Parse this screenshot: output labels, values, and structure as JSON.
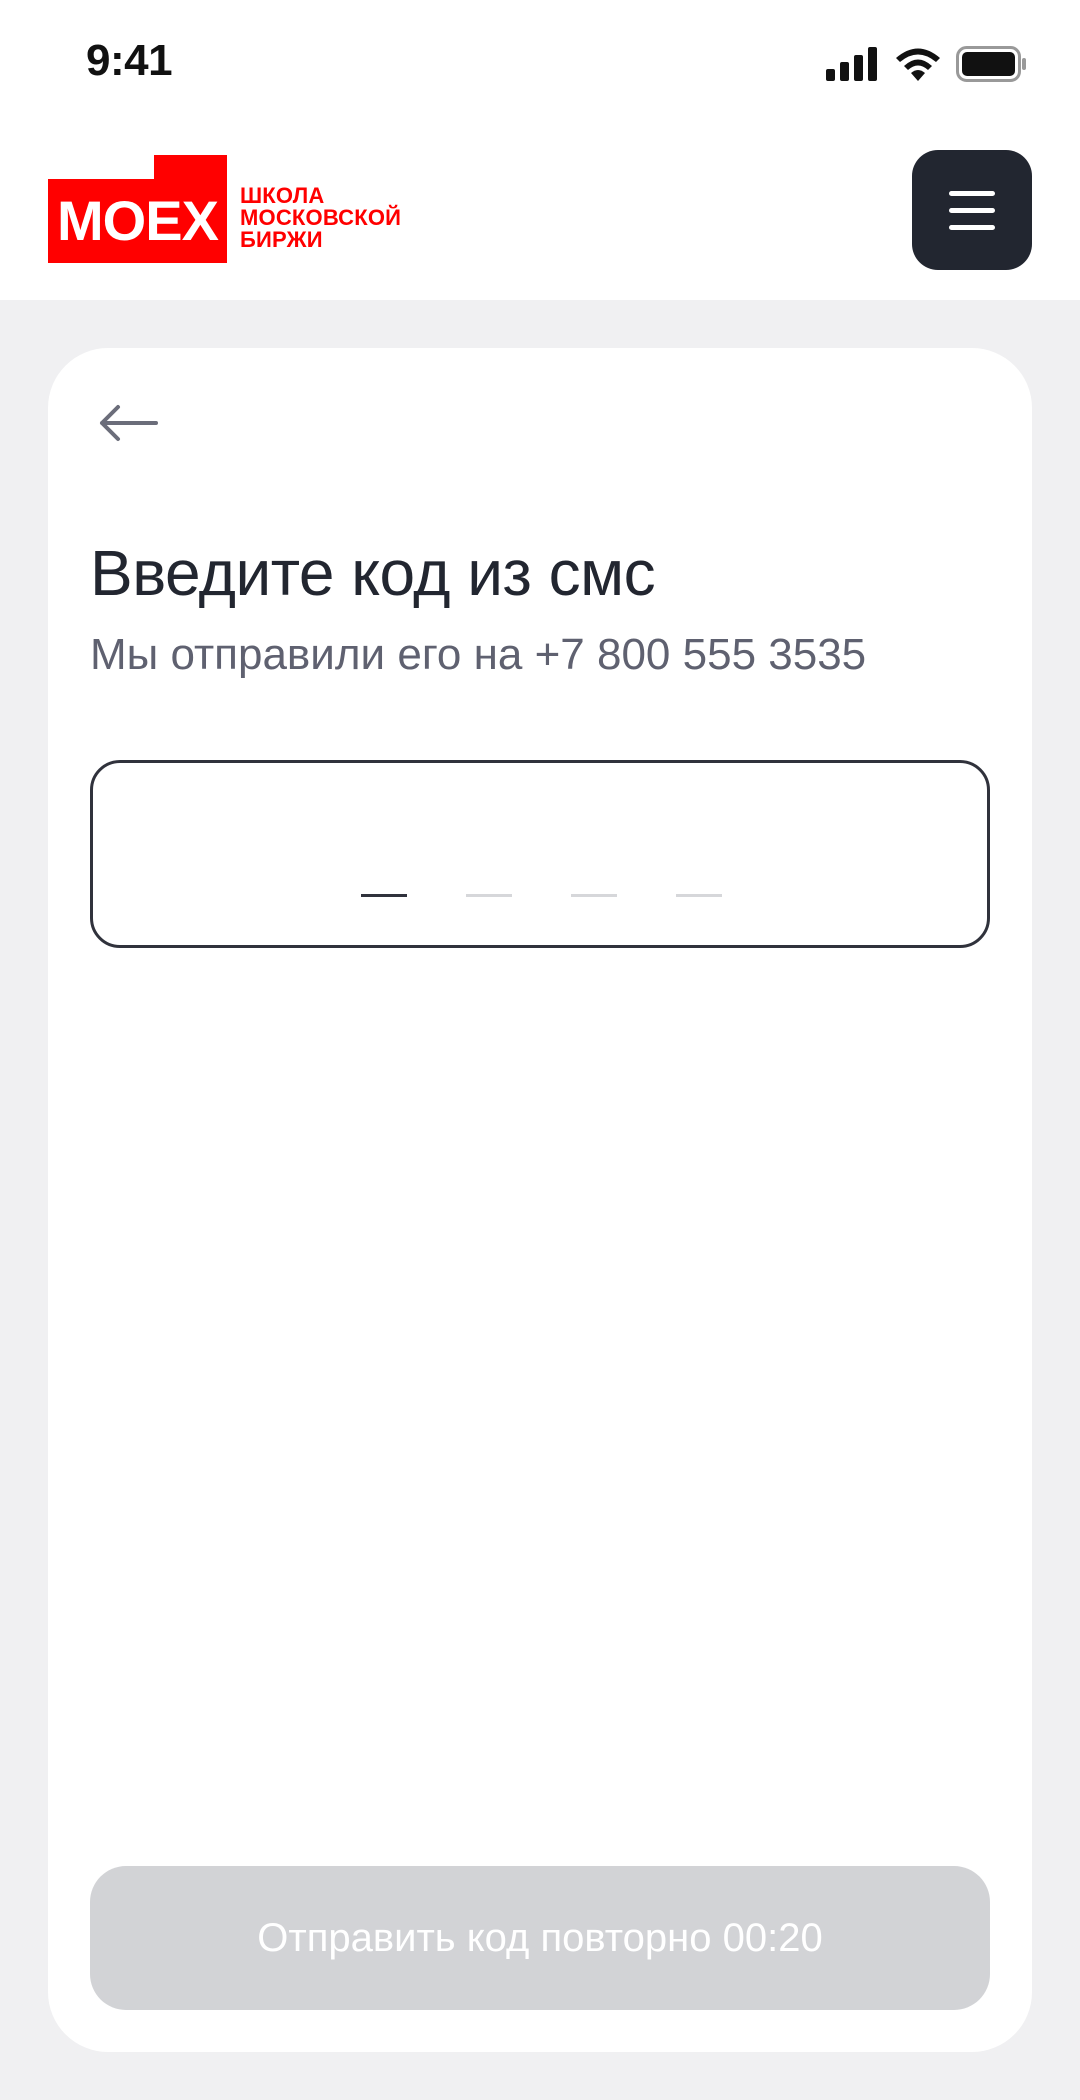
{
  "status_bar": {
    "time": "9:41",
    "icons": [
      "cellular-signal-icon",
      "wifi-icon",
      "battery-icon"
    ]
  },
  "header": {
    "logo": {
      "mark": "MOEX",
      "text_lines": [
        "ШКОЛА",
        "МОСКОВСКОЙ",
        "БИРЖИ"
      ],
      "color": "#ff0000"
    },
    "menu_icon": "hamburger-menu-icon",
    "menu_bg_color": "#222630"
  },
  "form": {
    "back_icon": "arrow-left-icon",
    "title": "Введите код из смс",
    "subtitle": "Мы отправили его на +7 800 555 3535",
    "code_input": {
      "slots": 4,
      "active_slot": 1
    },
    "resend_button": {
      "label": "Отправить код повторно 00:20",
      "disabled": true,
      "color": "#d2d3d6"
    }
  }
}
